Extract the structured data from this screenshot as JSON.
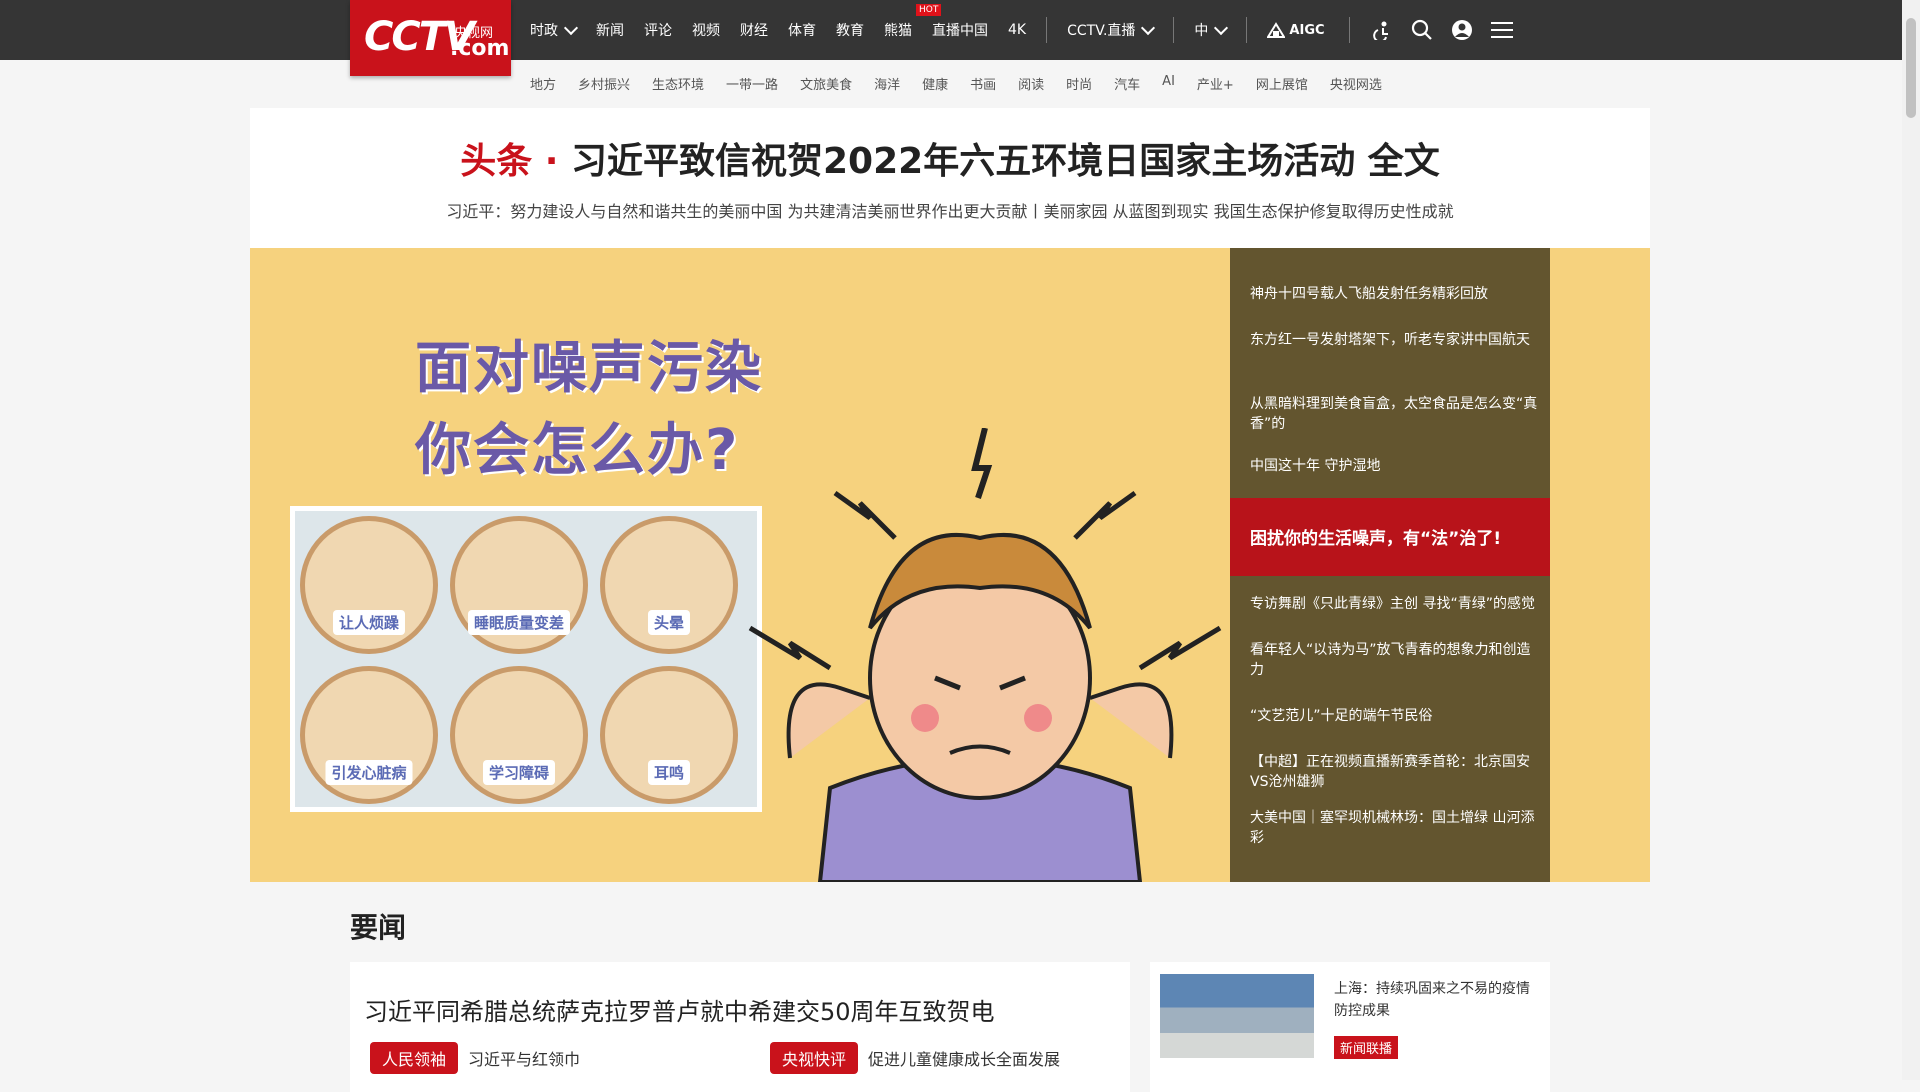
{
  "logo": {
    "mark": "CCTV",
    "cn": "央视网",
    "com": ".com"
  },
  "nav": {
    "items": [
      "时政",
      "新闻",
      "评论",
      "视频",
      "财经",
      "体育",
      "教育",
      "熊猫",
      "直播中国",
      "4K"
    ],
    "hot_badge": "HOT",
    "live": "CCTV.直播",
    "lang": "中",
    "aigc": "AIGC"
  },
  "subnav": [
    "地方",
    "乡村振兴",
    "生态环境",
    "一带一路",
    "文旅美食",
    "海洋",
    "健康",
    "书画",
    "阅读",
    "时尚",
    "汽车",
    "AI",
    "产业+",
    "网上展馆",
    "央视网选"
  ],
  "headline": {
    "tag": "头条 · ",
    "title": "习近平致信祝贺2022年六五环境日国家主场活动 全文",
    "sub": "习近平：努力建设人与自然和谐共生的美丽中国 为共建清洁美丽世界作出更大贡献丨美丽家园 从蓝图到现实 我国生态保护修复取得历史性成就"
  },
  "hero": {
    "title_line1": "面对噪声污染",
    "title_line2": "你会怎么办?",
    "symptoms": [
      "让人烦躁",
      "睡眠质量变差",
      "头晕",
      "引发心脏病",
      "学习障碍",
      "耳鸣"
    ],
    "side_items": [
      "神舟十四号载人飞船发射任务精彩回放",
      "东方红一号发射塔架下，听老专家讲中国航天",
      "从黑暗料理到美食盲盒，太空食品是怎么变“真香”的",
      "中国这十年 守护湿地",
      "专访舞剧《只此青绿》主创 寻找“青绿”的感觉",
      "看年轻人“以诗为马”放飞青春的想象力和创造力",
      "“文艺范儿”十足的端午节民俗",
      "【中超】正在视频直播新赛季首轮：北京国安VS沧州雄狮",
      "大美中国｜塞罕坝机械林场：国土增绿 山河添彩"
    ],
    "active_item": "困扰你的生活噪声，有“法”治了!"
  },
  "news": {
    "section": "要闻",
    "headline": "习近平同希腊总统萨克拉罗普卢就中希建交50周年互致贺电",
    "pill1": "人民领袖",
    "text1": "习近平与红领巾",
    "pill2": "央视快评",
    "text2": "促进儿童健康成长全面发展"
  },
  "sidecard": {
    "text": "上海：持续巩固来之不易的疫情防控成果",
    "tag": "新闻联播"
  }
}
